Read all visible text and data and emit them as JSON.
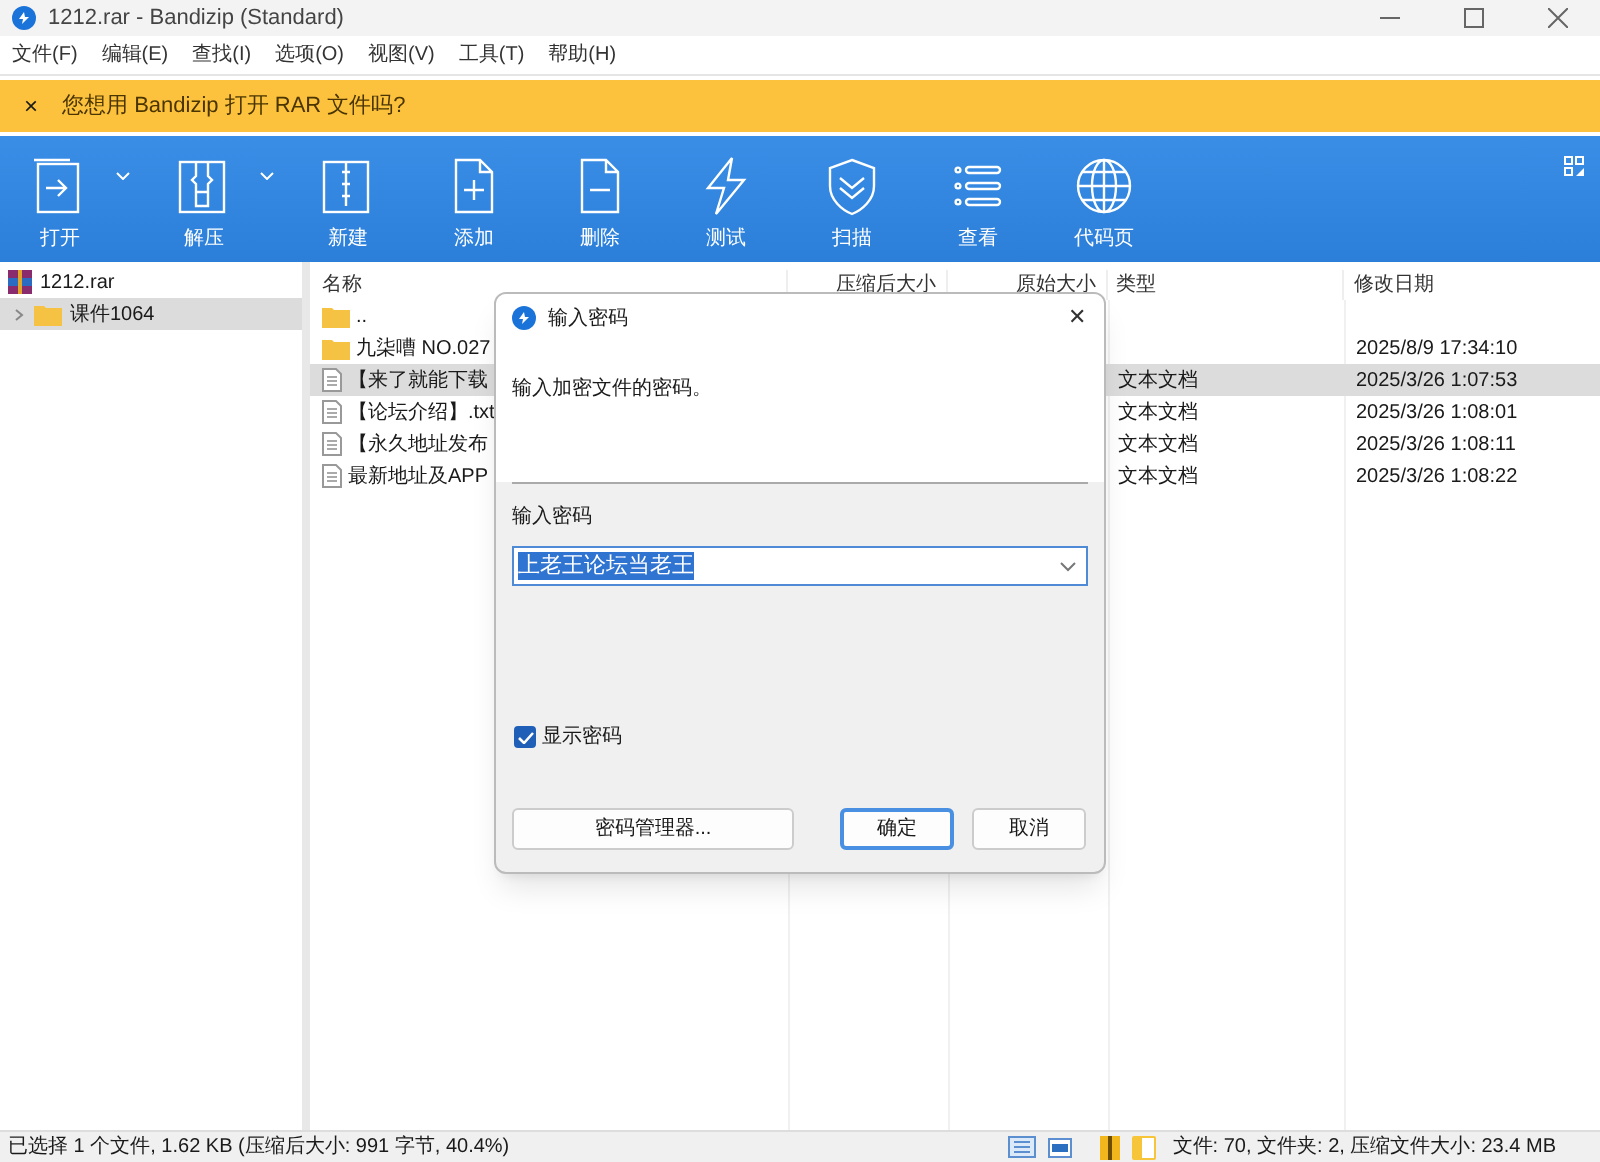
{
  "window": {
    "title": "1212.rar - Bandizip (Standard)"
  },
  "menu": [
    "文件(F)",
    "编辑(E)",
    "查找(I)",
    "选项(O)",
    "视图(V)",
    "工具(T)",
    "帮助(H)"
  ],
  "banner": {
    "close": "×",
    "text": "您想用 Bandizip 打开 RAR 文件吗?"
  },
  "toolbar": [
    {
      "kind": "open",
      "label": "打开",
      "dropdown": true
    },
    {
      "kind": "extract",
      "label": "解压",
      "dropdown": true
    },
    {
      "kind": "new",
      "label": "新建",
      "dropdown": false
    },
    {
      "kind": "add",
      "label": "添加",
      "dropdown": false
    },
    {
      "kind": "delete",
      "label": "删除",
      "dropdown": false
    },
    {
      "kind": "test",
      "label": "测试",
      "dropdown": false
    },
    {
      "kind": "scan",
      "label": "扫描",
      "dropdown": false
    },
    {
      "kind": "view",
      "label": "查看",
      "dropdown": false
    },
    {
      "kind": "codepage",
      "label": "代码页",
      "dropdown": false
    }
  ],
  "tree": [
    {
      "label": "1212.rar",
      "kind": "archive",
      "selected": false,
      "children": [
        {
          "label": "课件1064",
          "kind": "folder",
          "selected": true,
          "expanded": false
        }
      ]
    }
  ],
  "table": {
    "columns": [
      "名称",
      "压缩后大小",
      "原始大小",
      "类型",
      "修改日期"
    ],
    "rows": [
      {
        "kind": "folder",
        "name": "..",
        "type": "",
        "modified": "",
        "selected": false
      },
      {
        "kind": "folder",
        "name": "九柒嘈 NO.027",
        "type": "",
        "modified": "2025/8/9 17:34:10",
        "selected": false
      },
      {
        "kind": "text",
        "name": "【来了就能下载",
        "type": "文本文档",
        "modified": "2025/3/26 1:07:53",
        "selected": true
      },
      {
        "kind": "text",
        "name": "【论坛介绍】.txt",
        "type": "文本文档",
        "modified": "2025/3/26 1:08:01",
        "selected": false
      },
      {
        "kind": "text",
        "name": "【永久地址发布",
        "type": "文本文档",
        "modified": "2025/3/26 1:08:11",
        "selected": false
      },
      {
        "kind": "text",
        "name": "最新地址及APP",
        "type": "文本文档",
        "modified": "2025/3/26 1:08:22",
        "selected": false
      }
    ]
  },
  "dialog": {
    "title": "输入密码",
    "close": "✕",
    "message": "输入加密文件的密码。",
    "field_label": "输入密码",
    "password": "上老王论坛当老王",
    "show_password": {
      "label": "显示密码",
      "checked": true
    },
    "buttons": [
      {
        "label": "密码管理器...",
        "default": false
      },
      {
        "label": "确定",
        "default": true
      },
      {
        "label": "取消",
        "default": false
      }
    ]
  },
  "status_bar": {
    "left": "已选择 1 个文件, 1.62 KB (压缩后大小: 991 字节, 40.4%)",
    "right": "文件: 70, 文件夹: 2, 压缩文件大小: 23.4 MB"
  }
}
